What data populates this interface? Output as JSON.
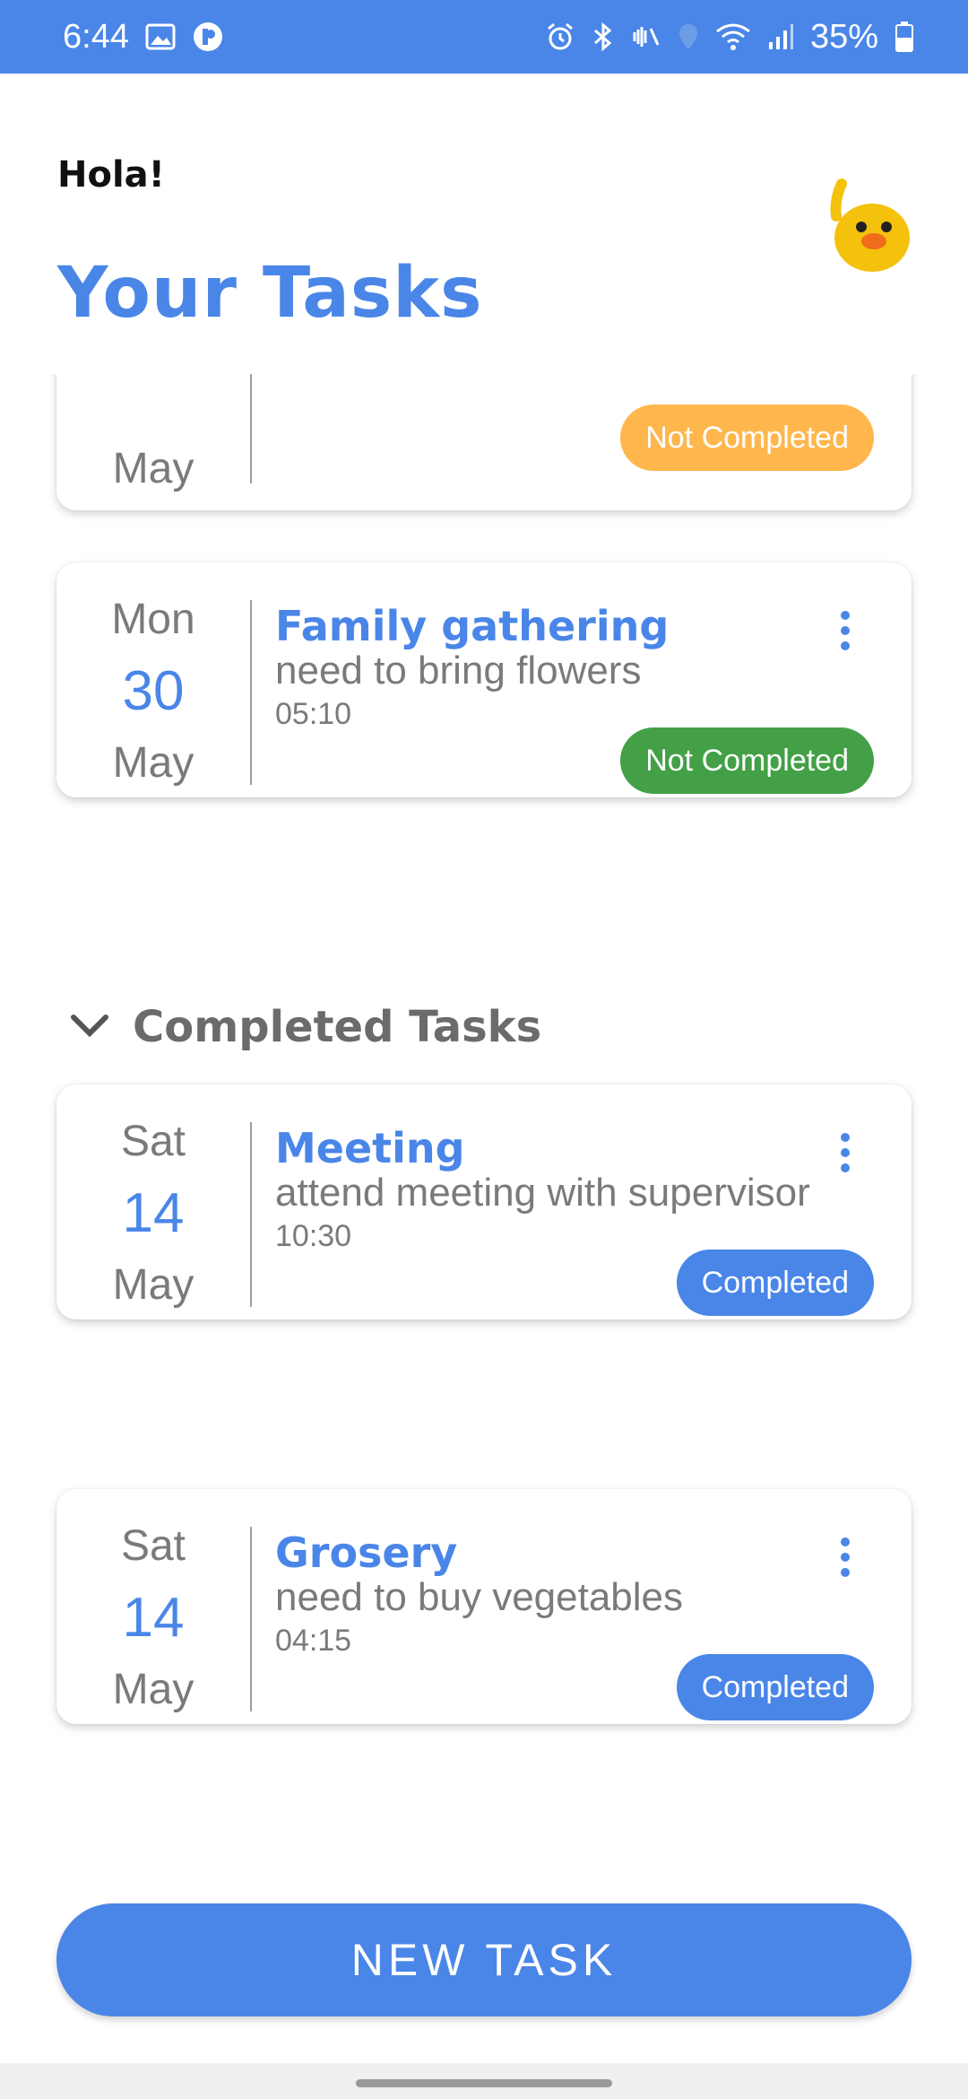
{
  "status_bar": {
    "time": "6:44",
    "battery": "35%",
    "icons": [
      "gallery-icon",
      "app-notification-icon",
      "alarm-icon",
      "bluetooth-icon",
      "vibrate-icon",
      "location-icon",
      "wifi-icon",
      "signal-icon",
      "battery-icon"
    ]
  },
  "header": {
    "greeting": "Hola!",
    "title": "Your Tasks",
    "mascot_icon": "waving-duck-icon"
  },
  "tasks": [
    {
      "day": "",
      "date": "",
      "month": "May",
      "title": "",
      "description": "",
      "time": "",
      "status": "Not Completed",
      "status_color": "#ffb74d"
    },
    {
      "day": "Mon",
      "date": "30",
      "month": "May",
      "title": "Family gathering",
      "description": "need to bring flowers",
      "time": "05:10",
      "status": "Not Completed",
      "status_color": "#43a047"
    }
  ],
  "completed_section": {
    "title": "Completed Tasks",
    "collapse_icon": "chevron-down-icon"
  },
  "completed_tasks": [
    {
      "day": "Sat",
      "date": "14",
      "month": "May",
      "title": "Meeting",
      "description": "attend meeting with supervisor",
      "time": "10:30",
      "status": "Completed",
      "status_color": "#4a86e8"
    },
    {
      "day": "Sat",
      "date": "14",
      "month": "May",
      "title": "Grosery",
      "description": "need to buy vegetables",
      "time": "04:15",
      "status": "Completed",
      "status_color": "#4a86e8"
    }
  ],
  "new_task_button": "NEW TASK",
  "colors": {
    "accent": "#4a86e8",
    "text_muted": "#7a7a7a"
  }
}
